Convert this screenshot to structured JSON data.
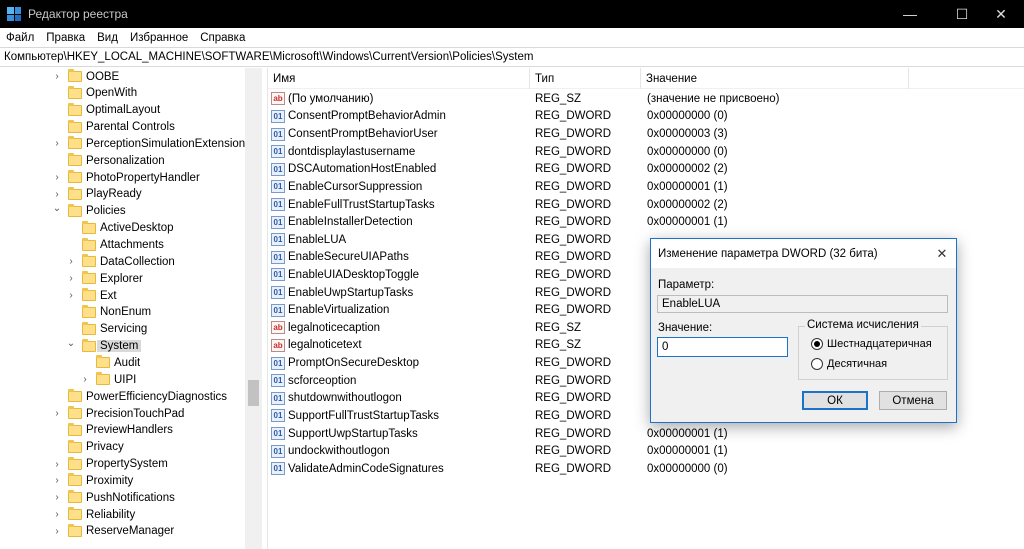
{
  "window": {
    "title": "Редактор реестра",
    "minimize_glyph": "—",
    "maximize_glyph": "☐",
    "close_glyph": "✕"
  },
  "menu": [
    "Файл",
    "Правка",
    "Вид",
    "Избранное",
    "Справка"
  ],
  "address": "Компьютер\\HKEY_LOCAL_MACHINE\\SOFTWARE\\Microsoft\\Windows\\CurrentVersion\\Policies\\System",
  "tree": [
    {
      "label": "OOBE",
      "level": 0,
      "expander": "collapsed"
    },
    {
      "label": "OpenWith",
      "level": 0,
      "expander": "none"
    },
    {
      "label": "OptimalLayout",
      "level": 0,
      "expander": "none"
    },
    {
      "label": "Parental Controls",
      "level": 0,
      "expander": "none"
    },
    {
      "label": "PerceptionSimulationExtensions",
      "level": 0,
      "expander": "collapsed"
    },
    {
      "label": "Personalization",
      "level": 0,
      "expander": "none"
    },
    {
      "label": "PhotoPropertyHandler",
      "level": 0,
      "expander": "collapsed"
    },
    {
      "label": "PlayReady",
      "level": 0,
      "expander": "collapsed"
    },
    {
      "label": "Policies",
      "level": 0,
      "expander": "expanded"
    },
    {
      "label": "ActiveDesktop",
      "level": 1,
      "expander": "none"
    },
    {
      "label": "Attachments",
      "level": 1,
      "expander": "none"
    },
    {
      "label": "DataCollection",
      "level": 1,
      "expander": "collapsed"
    },
    {
      "label": "Explorer",
      "level": 1,
      "expander": "collapsed"
    },
    {
      "label": "Ext",
      "level": 1,
      "expander": "collapsed"
    },
    {
      "label": "NonEnum",
      "level": 1,
      "expander": "none"
    },
    {
      "label": "Servicing",
      "level": 1,
      "expander": "none"
    },
    {
      "label": "System",
      "level": 1,
      "expander": "expanded",
      "selected": true
    },
    {
      "label": "Audit",
      "level": 2,
      "expander": "none"
    },
    {
      "label": "UIPI",
      "level": 2,
      "expander": "collapsed"
    },
    {
      "label": "PowerEfficiencyDiagnostics",
      "level": 0,
      "expander": "none"
    },
    {
      "label": "PrecisionTouchPad",
      "level": 0,
      "expander": "collapsed"
    },
    {
      "label": "PreviewHandlers",
      "level": 0,
      "expander": "none"
    },
    {
      "label": "Privacy",
      "level": 0,
      "expander": "none"
    },
    {
      "label": "PropertySystem",
      "level": 0,
      "expander": "collapsed"
    },
    {
      "label": "Proximity",
      "level": 0,
      "expander": "collapsed"
    },
    {
      "label": "PushNotifications",
      "level": 0,
      "expander": "collapsed"
    },
    {
      "label": "Reliability",
      "level": 0,
      "expander": "collapsed"
    },
    {
      "label": "ReserveManager",
      "level": 0,
      "expander": "collapsed"
    }
  ],
  "list": {
    "headers": {
      "name": "Имя",
      "type": "Тип",
      "data": "Значение"
    },
    "rows": [
      {
        "name": "(По умолчанию)",
        "type": "REG_SZ",
        "data": "(значение не присвоено)",
        "kind": "sz"
      },
      {
        "name": "ConsentPromptBehaviorAdmin",
        "type": "REG_DWORD",
        "data": "0x00000000 (0)",
        "kind": "dword"
      },
      {
        "name": "ConsentPromptBehaviorUser",
        "type": "REG_DWORD",
        "data": "0x00000003 (3)",
        "kind": "dword"
      },
      {
        "name": "dontdisplaylastusername",
        "type": "REG_DWORD",
        "data": "0x00000000 (0)",
        "kind": "dword"
      },
      {
        "name": "DSCAutomationHostEnabled",
        "type": "REG_DWORD",
        "data": "0x00000002 (2)",
        "kind": "dword"
      },
      {
        "name": "EnableCursorSuppression",
        "type": "REG_DWORD",
        "data": "0x00000001 (1)",
        "kind": "dword"
      },
      {
        "name": "EnableFullTrustStartupTasks",
        "type": "REG_DWORD",
        "data": "0x00000002 (2)",
        "kind": "dword"
      },
      {
        "name": "EnableInstallerDetection",
        "type": "REG_DWORD",
        "data": "0x00000001 (1)",
        "kind": "dword"
      },
      {
        "name": "EnableLUA",
        "type": "REG_DWORD",
        "data": "",
        "kind": "dword"
      },
      {
        "name": "EnableSecureUIAPaths",
        "type": "REG_DWORD",
        "data": "",
        "kind": "dword"
      },
      {
        "name": "EnableUIADesktopToggle",
        "type": "REG_DWORD",
        "data": "",
        "kind": "dword"
      },
      {
        "name": "EnableUwpStartupTasks",
        "type": "REG_DWORD",
        "data": "",
        "kind": "dword"
      },
      {
        "name": "EnableVirtualization",
        "type": "REG_DWORD",
        "data": "",
        "kind": "dword"
      },
      {
        "name": "legalnoticecaption",
        "type": "REG_SZ",
        "data": "",
        "kind": "sz"
      },
      {
        "name": "legalnoticetext",
        "type": "REG_SZ",
        "data": "",
        "kind": "sz"
      },
      {
        "name": "PromptOnSecureDesktop",
        "type": "REG_DWORD",
        "data": "",
        "kind": "dword"
      },
      {
        "name": "scforceoption",
        "type": "REG_DWORD",
        "data": "",
        "kind": "dword"
      },
      {
        "name": "shutdownwithoutlogon",
        "type": "REG_DWORD",
        "data": "",
        "kind": "dword"
      },
      {
        "name": "SupportFullTrustStartupTasks",
        "type": "REG_DWORD",
        "data": "",
        "kind": "dword"
      },
      {
        "name": "SupportUwpStartupTasks",
        "type": "REG_DWORD",
        "data": "0x00000001 (1)",
        "kind": "dword"
      },
      {
        "name": "undockwithoutlogon",
        "type": "REG_DWORD",
        "data": "0x00000001 (1)",
        "kind": "dword"
      },
      {
        "name": "ValidateAdminCodeSignatures",
        "type": "REG_DWORD",
        "data": "0x00000000 (0)",
        "kind": "dword"
      }
    ]
  },
  "icons": {
    "sz": "ab",
    "dword": "01"
  },
  "dialog": {
    "title": "Изменение параметра DWORD (32 бита)",
    "close_glyph": "✕",
    "param_label": "Параметр:",
    "param_value": "EnableLUA",
    "value_label": "Значение:",
    "value": "0",
    "radix_label": "Система исчисления",
    "radix_options": [
      {
        "label": "Шестнадцатеричная",
        "checked": true
      },
      {
        "label": "Десятичная",
        "checked": false
      }
    ],
    "ok_label": "ОК",
    "cancel_label": "Отмена"
  },
  "colors": {
    "accent": "#1a73c9",
    "titlebar": "#000000",
    "selection": "#d9d9d9",
    "folder": "#ffe08a"
  }
}
